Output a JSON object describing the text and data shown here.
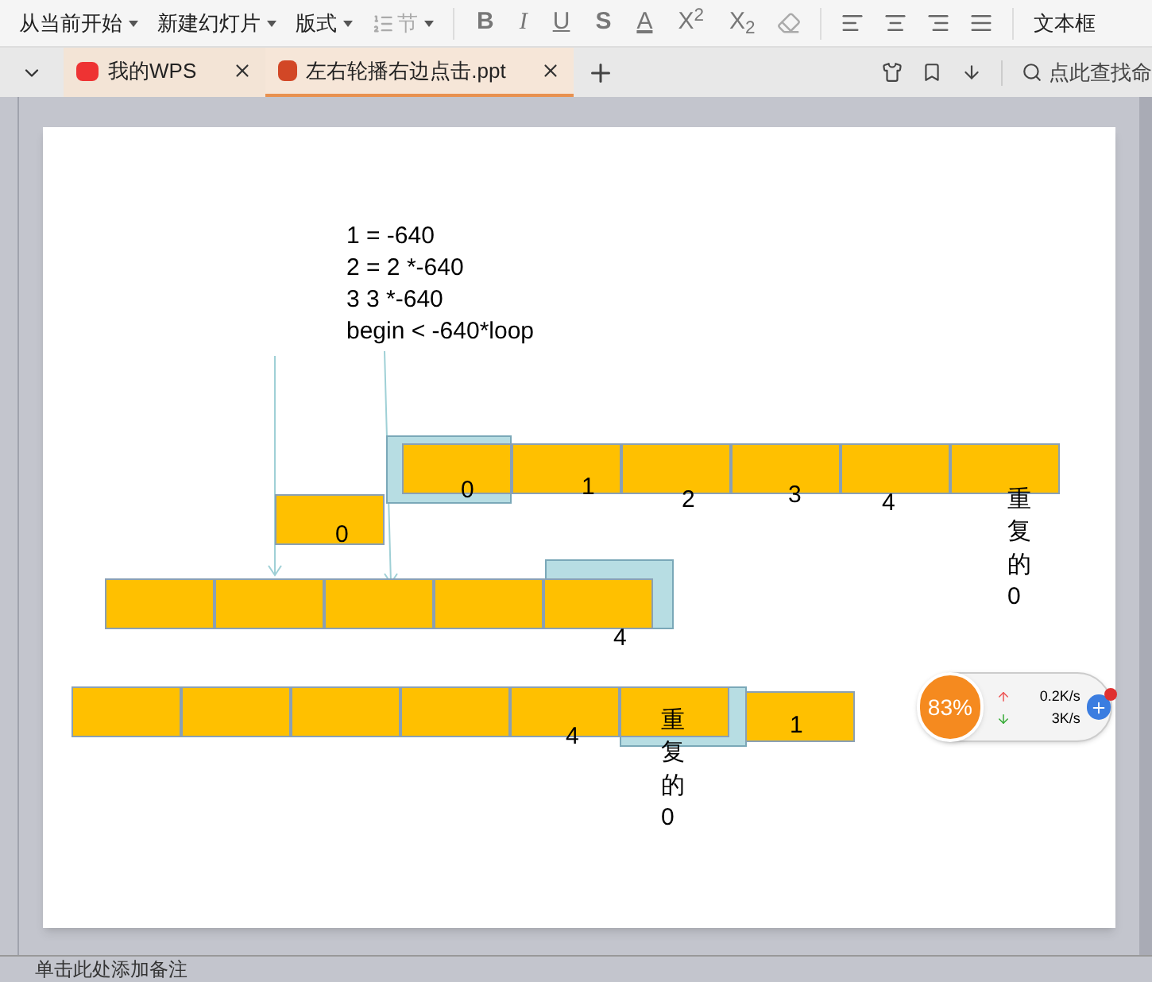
{
  "toolbar": {
    "menus": [
      {
        "label": "从当前开始",
        "disabled": false
      },
      {
        "label": "新建幻灯片",
        "disabled": false
      },
      {
        "label": "版式",
        "disabled": false
      },
      {
        "label": "节",
        "disabled": true
      }
    ],
    "format_buttons": [
      {
        "label": "B",
        "kind": "bold"
      },
      {
        "label": "I",
        "kind": "italic"
      },
      {
        "label": "U",
        "kind": "underline"
      },
      {
        "label": "S",
        "kind": "shadow"
      },
      {
        "label": "A",
        "kind": "color"
      },
      {
        "label": "X$^{2}$",
        "kind": "script"
      },
      {
        "label": "X$_{2}$",
        "kind": "script"
      }
    ],
    "textbox_label": "文本框"
  },
  "tabs": [
    {
      "label": "我的WPS",
      "kind": "home",
      "selected": false
    },
    {
      "label": "左右轮播右边点击.ppt",
      "kind": "ppt",
      "selected": true
    }
  ],
  "search": {
    "placeholder": "点此查找命"
  },
  "slide": {
    "code_lines": [
      "1 = -640",
      "2 = 2 *-640",
      "3 3 *-640",
      "begin < -640*loop"
    ],
    "row_1_labels": [
      "0",
      "1",
      "2",
      "3",
      "4",
      "重复的0"
    ],
    "single_label": "0",
    "row_2_label": "4",
    "row_3_labels": [
      "4",
      "重复的0",
      "1"
    ]
  },
  "speed_widget": {
    "percent": "83%",
    "upload": "0.2K/s",
    "download": "3K/s"
  },
  "notes": {
    "placeholder": "单击此处添加备注"
  }
}
